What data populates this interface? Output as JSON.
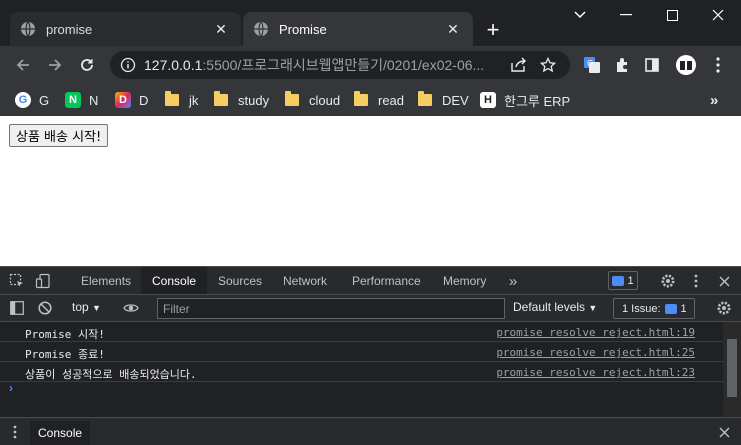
{
  "browser": {
    "tabs": [
      {
        "label": "promise",
        "active": false
      },
      {
        "label": "Promise",
        "active": true
      }
    ],
    "url_host": "127.0.0.1",
    "url_rest": ":5500/프로그래시브웹앱만들기/0201/ex02-06...",
    "bookmarks": [
      {
        "label": "G",
        "icon": "google-icon"
      },
      {
        "label": "N",
        "icon": "naver-icon"
      },
      {
        "label": "D",
        "icon": "d-icon"
      },
      {
        "label": "jk",
        "icon": "folder-icon"
      },
      {
        "label": "study",
        "icon": "folder-icon"
      },
      {
        "label": "cloud",
        "icon": "folder-icon"
      },
      {
        "label": "read",
        "icon": "folder-icon"
      },
      {
        "label": "DEV",
        "icon": "folder-icon"
      },
      {
        "label": "한그루 ERP",
        "icon": "h-icon"
      }
    ]
  },
  "page": {
    "button_label": "상품 배송 시작!"
  },
  "devtools": {
    "tabs": [
      "Elements",
      "Console",
      "Sources",
      "Network",
      "Performance",
      "Memory"
    ],
    "active_tab": "Console",
    "message_count": "1",
    "context": "top",
    "filter_placeholder": "Filter",
    "levels": "Default levels",
    "issues_label": "1 Issue:",
    "issues_count": "1",
    "logs": [
      {
        "message": "Promise 시작!",
        "source": "promise resolve reject.html:19"
      },
      {
        "message": "Promise 종료!",
        "source": "promise resolve reject.html:25"
      },
      {
        "message": "상품이 성공적으로 배송되었습니다.",
        "source": "promise resolve reject.html:23"
      }
    ],
    "drawer_tab": "Console"
  },
  "colors": {
    "accent": "#4b8cf6",
    "folder": "#f5cd60"
  }
}
